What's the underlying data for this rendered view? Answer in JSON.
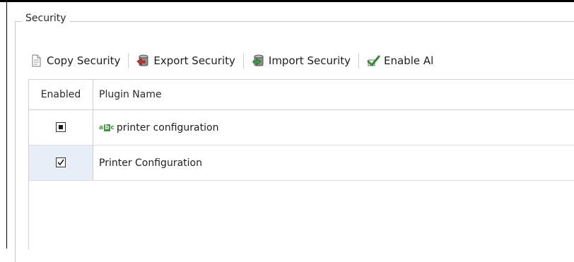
{
  "group": {
    "title": "Security"
  },
  "toolbar": {
    "buttons": [
      {
        "label": "Copy Security",
        "icon": "copy-document-icon"
      },
      {
        "label": "Export Security",
        "icon": "export-db-icon"
      },
      {
        "label": "Import Security",
        "icon": "import-db-icon"
      },
      {
        "label": "Enable Al",
        "icon": "checkmark-edit-icon"
      }
    ]
  },
  "grid": {
    "columns": [
      "Enabled",
      "Plugin Name"
    ],
    "rows": [
      {
        "enabled": "indeterminate",
        "name_icon": "string-type-icon",
        "name": "printer configuration"
      },
      {
        "enabled": "checked",
        "name": "Printer Configuration",
        "selected": true
      }
    ]
  },
  "colors": {
    "selection": "#e7eef8",
    "accent_green": "#3a9a3a",
    "border": "#cfcfcf"
  }
}
